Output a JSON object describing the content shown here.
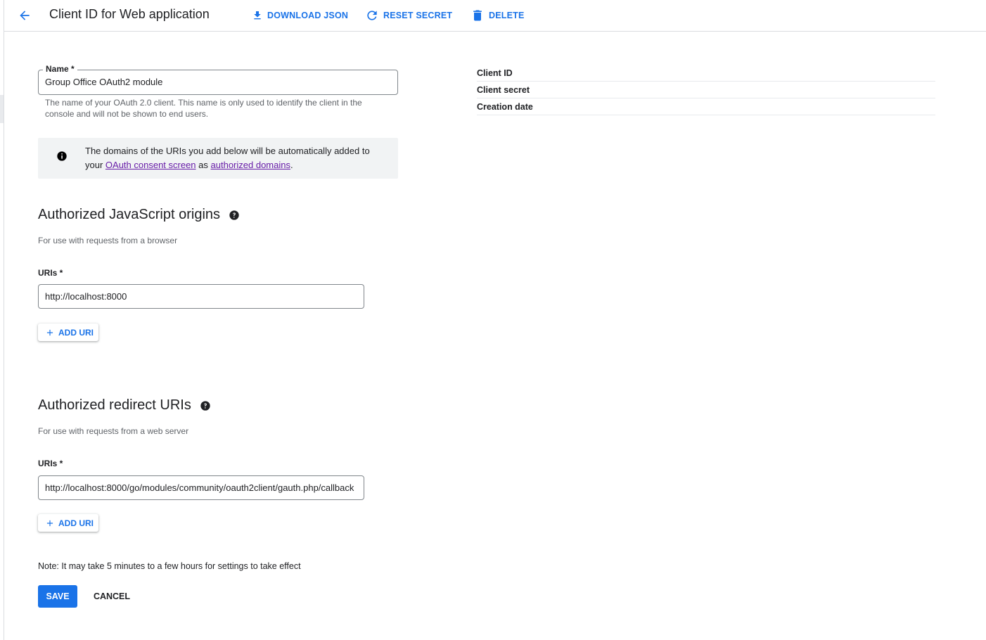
{
  "header": {
    "title": "Client ID for Web application",
    "actions": {
      "download": "DOWNLOAD JSON",
      "reset": "RESET SECRET",
      "delete": "DELETE"
    }
  },
  "form": {
    "name": {
      "label": "Name *",
      "value": "Group Office OAuth2 module",
      "help": "The name of your OAuth 2.0 client. This name is only used to identify the client in the console and will not be shown to end users."
    },
    "info": {
      "text_before": "The domains of the URIs you add below will be automatically added to your ",
      "link1": "OAuth consent screen",
      "text_middle": " as ",
      "link2": "authorized domains",
      "text_after": "."
    },
    "js_origins": {
      "title": "Authorized JavaScript origins",
      "subtitle": "For use with requests from a browser",
      "uris_label": "URIs *",
      "uri_value": "http://localhost:8000",
      "add_label": "ADD URI"
    },
    "redirect_uris": {
      "title": "Authorized redirect URIs",
      "subtitle": "For use with requests from a web server",
      "uris_label": "URIs *",
      "uri_value": "http://localhost:8000/go/modules/community/oauth2client/gauth.php/callback",
      "add_label": "ADD URI"
    },
    "note": "Note: It may take 5 minutes to a few hours for settings to take effect",
    "save_label": "SAVE",
    "cancel_label": "CANCEL"
  },
  "details": {
    "client_id_label": "Client ID",
    "client_secret_label": "Client secret",
    "creation_date_label": "Creation date"
  },
  "colors": {
    "accent": "#1a73e8",
    "link_visited": "#681da8",
    "info_bg": "#f1f3f4",
    "border": "#80868b"
  },
  "icons": {
    "back": "arrow-left-icon",
    "download": "download-icon",
    "reset": "refresh-icon",
    "delete": "trash-icon",
    "info": "info-icon",
    "help": "help-circle-icon",
    "add": "plus-icon"
  }
}
